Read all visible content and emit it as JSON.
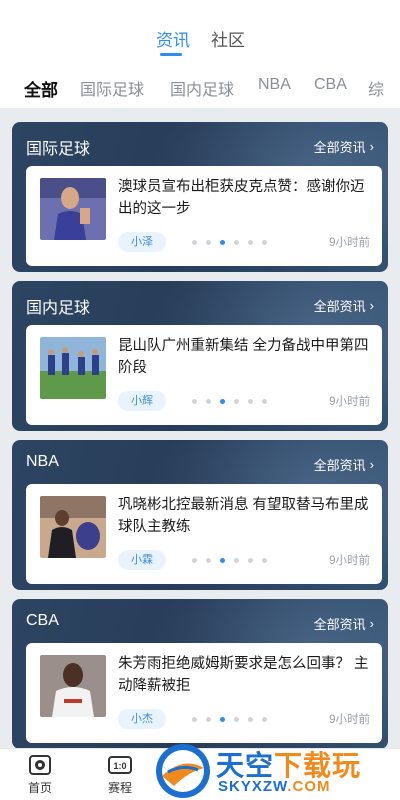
{
  "header": {
    "tabs": [
      {
        "label": "资讯",
        "active": true
      },
      {
        "label": "社区",
        "active": false
      }
    ]
  },
  "categories": [
    {
      "label": "全部",
      "active": true
    },
    {
      "label": "国际足球",
      "active": false
    },
    {
      "label": "国内足球",
      "active": false
    },
    {
      "label": "NBA",
      "active": false
    },
    {
      "label": "CBA",
      "active": false
    },
    {
      "label": "综",
      "active": false
    }
  ],
  "sections": [
    {
      "title": "国际足球",
      "more": "全部资讯",
      "headline": "澳球员宣布出柜获皮克点赞：感谢你迈出的这一步",
      "tag": "小泽",
      "time": "9小时前",
      "carousel_index": 3,
      "carousel_count": 6
    },
    {
      "title": "国内足球",
      "more": "全部资讯",
      "headline": "昆山队广州重新集结 全力备战中甲第四阶段",
      "tag": "小辉",
      "time": "9小时前",
      "carousel_index": 3,
      "carousel_count": 6
    },
    {
      "title": "NBA",
      "more": "全部资讯",
      "headline": "巩晓彬北控最新消息 有望取替马布里成球队主教练",
      "tag": "小霖",
      "time": "9小时前",
      "carousel_index": 3,
      "carousel_count": 6
    },
    {
      "title": "CBA",
      "more": "全部资讯",
      "headline": "朱芳雨拒绝威姆斯要求是怎么回事？ 主动降薪被拒",
      "tag": "小杰",
      "time": "9小时前",
      "carousel_index": 3,
      "carousel_count": 6
    }
  ],
  "bottom_nav": [
    {
      "label": "首页",
      "icon": "soccer-ball-icon"
    },
    {
      "label": "赛程",
      "icon": "scoreboard-icon"
    }
  ],
  "scoreboard_text": "1:0",
  "watermark": {
    "title_a": "天空",
    "title_b": "下载玩",
    "sub_a": "SKYXZW",
    "sub_b": ".COM"
  },
  "colors": {
    "accent": "#2a8ff0",
    "card_bg": "#2d4563",
    "tag_bg": "#e8f3fd"
  }
}
